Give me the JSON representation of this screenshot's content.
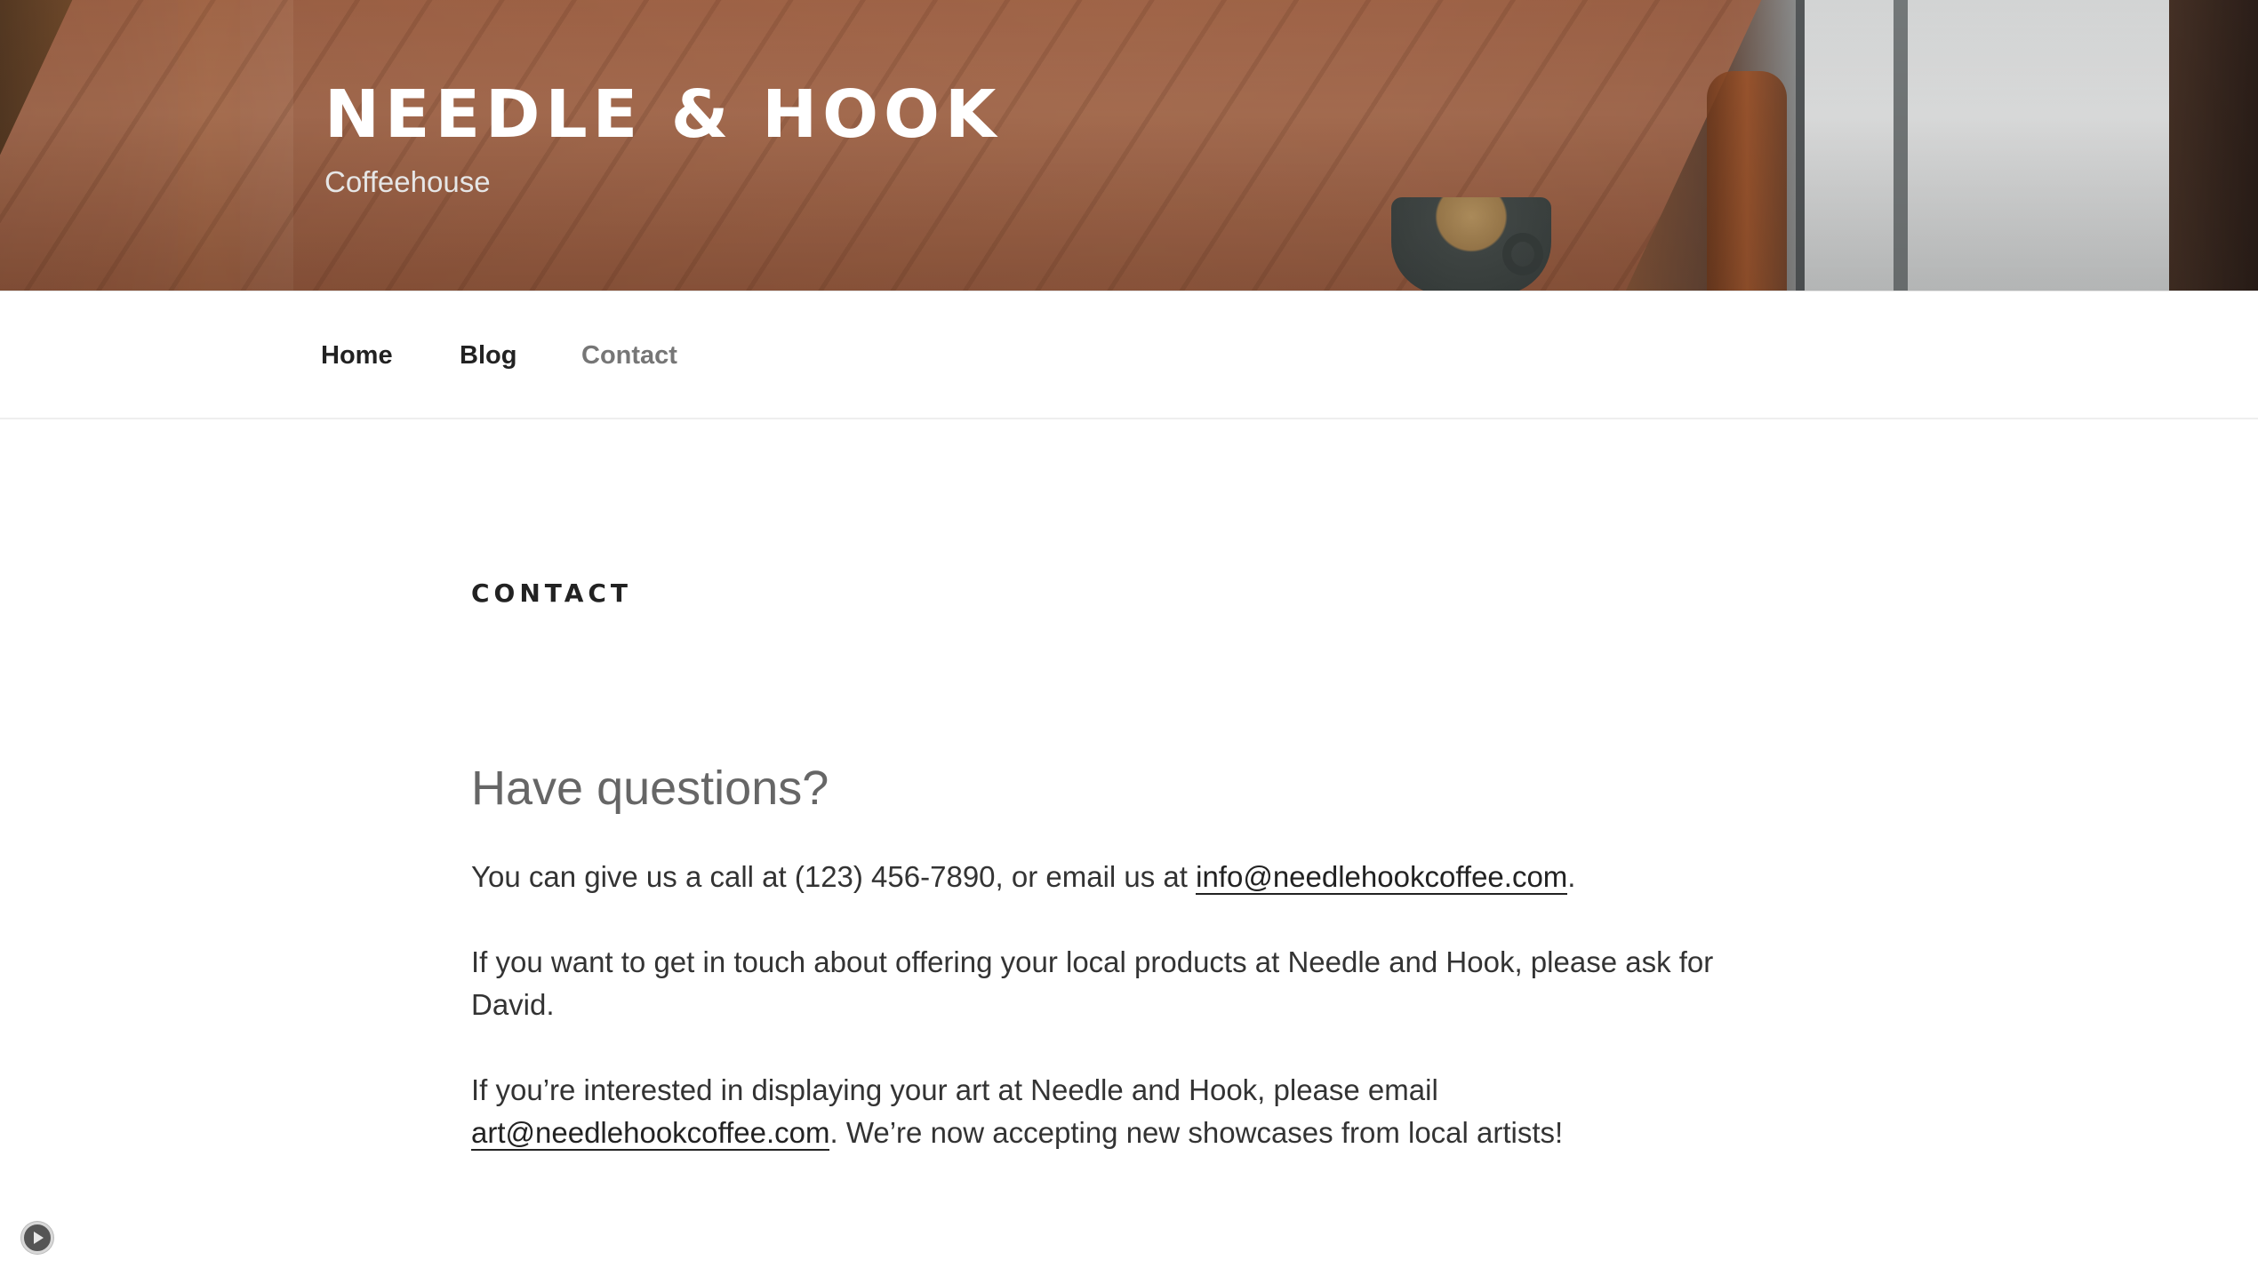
{
  "header": {
    "site_title": "NEEDLE & HOOK",
    "tagline": "Coffeehouse"
  },
  "nav": {
    "items": [
      {
        "label": "Home",
        "current": false
      },
      {
        "label": "Blog",
        "current": false
      },
      {
        "label": "Contact",
        "current": true
      }
    ]
  },
  "page": {
    "title": "CONTACT",
    "heading": "Have questions?",
    "para1": {
      "text_before": "You can give us a call at (123) 456-7890, or email us at ",
      "link": "info@needlehookcoffee.com",
      "text_after": "."
    },
    "para2": {
      "text": "If you want to get in touch about offering your local products at Needle and Hook, please ask for David."
    },
    "para3": {
      "text_before": "If you’re interested in displaying your art at Needle and Hook, please email ",
      "link": "art@needlehookcoffee.com",
      "text_after": ". We’re now accepting new showcases from local artists!"
    }
  },
  "widgets": {
    "play_button_icon": "play-icon"
  }
}
